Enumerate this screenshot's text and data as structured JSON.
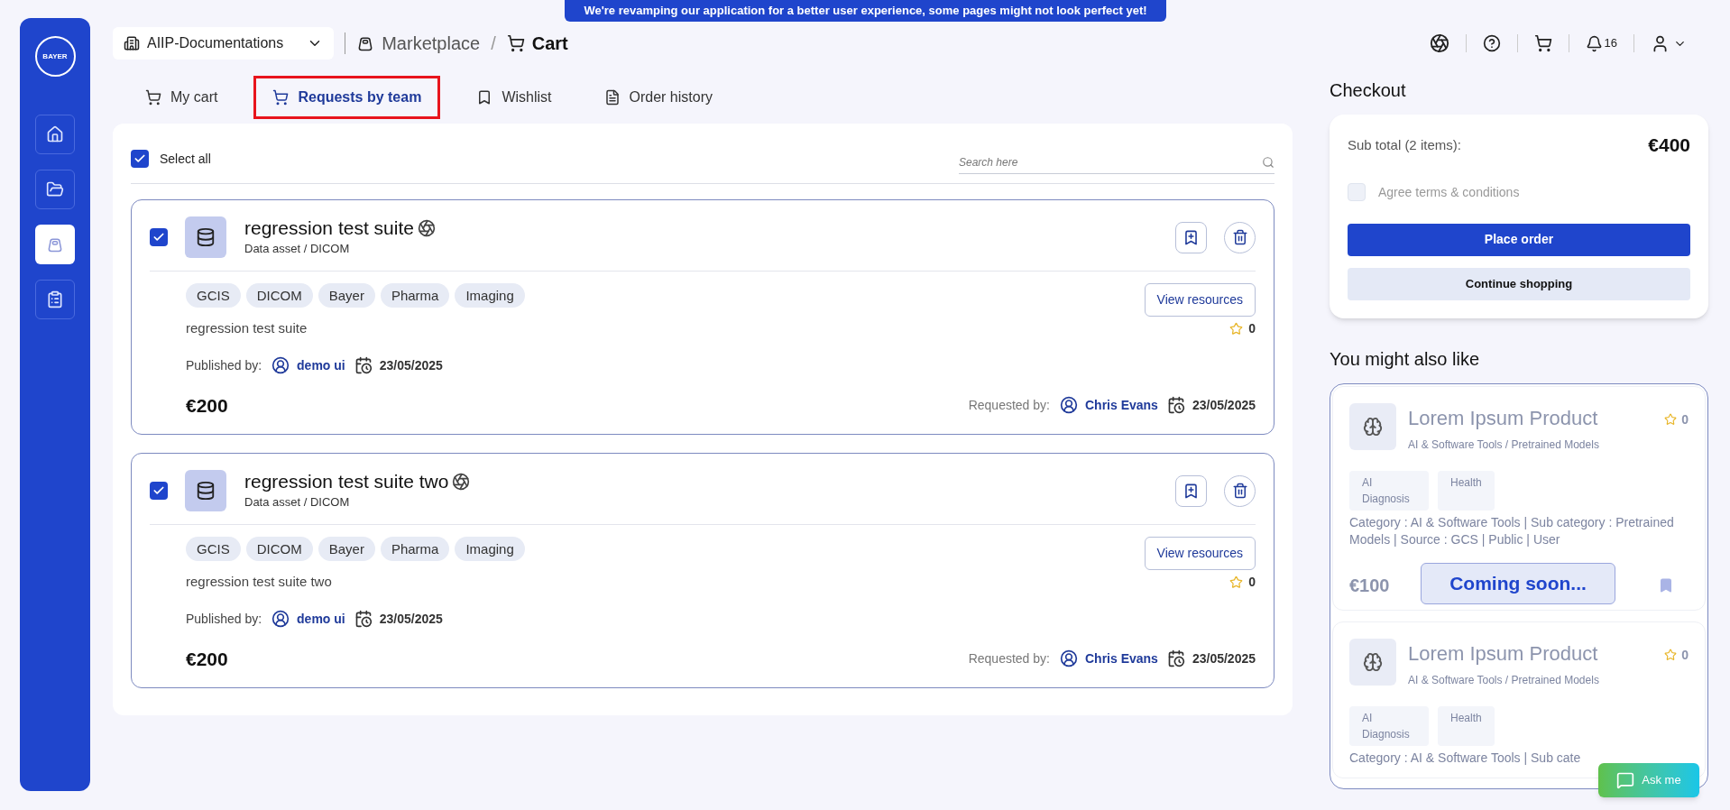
{
  "banner": "We're revamping our application for a better user experience, some pages might not look perfect yet!",
  "sidebar": {
    "logo": "BAYER",
    "items": [
      {
        "kind": "home",
        "selected": false
      },
      {
        "kind": "folder",
        "selected": false
      },
      {
        "kind": "marketplace",
        "selected": true
      },
      {
        "kind": "clipboard",
        "selected": false
      }
    ]
  },
  "workspace": "AIIP-Documentations",
  "breadcrumb": [
    {
      "label": "Marketplace",
      "current": false
    },
    {
      "label": "Cart",
      "current": true
    }
  ],
  "breadcrumb_separator": "/",
  "notifications": "16",
  "tabs": [
    {
      "label": "My cart",
      "kind": "cart",
      "selected": false
    },
    {
      "label": "Requests by team",
      "kind": "team",
      "selected": true
    },
    {
      "label": "Wishlist",
      "kind": "wishlist",
      "selected": false
    },
    {
      "label": "Order history",
      "kind": "history",
      "selected": false
    }
  ],
  "select_all": {
    "label": "Select all",
    "checked": true
  },
  "search": {
    "placeholder": "Search here"
  },
  "items": [
    {
      "checked": true,
      "title": "regression test suite",
      "subtitle": "Data asset / DICOM",
      "tags": [
        "GCIS",
        "DICOM",
        "Bayer",
        "Pharma",
        "Imaging"
      ],
      "view_button": "View resources",
      "description": "regression test suite",
      "rating": "0",
      "published_label": "Published by:",
      "publisher": "demo ui",
      "published_date": "23/05/2025",
      "price": "€200",
      "requested_label": "Requested by:",
      "requester": "Chris Evans",
      "requested_date": "23/05/2025"
    },
    {
      "checked": true,
      "title": "regression test suite two",
      "subtitle": "Data asset / DICOM",
      "tags": [
        "GCIS",
        "DICOM",
        "Bayer",
        "Pharma",
        "Imaging"
      ],
      "view_button": "View resources",
      "description": "regression test suite two",
      "rating": "0",
      "published_label": "Published by:",
      "publisher": "demo ui",
      "published_date": "23/05/2025",
      "price": "€200",
      "requested_label": "Requested by:",
      "requester": "Chris Evans",
      "requested_date": "23/05/2025"
    }
  ],
  "checkout": {
    "title": "Checkout",
    "subtotal_label": "Sub total (2 items):",
    "subtotal": "€400",
    "agree": {
      "label": "Agree terms & conditions",
      "checked": false
    },
    "place_order": "Place order",
    "continue": "Continue shopping"
  },
  "recommendations": {
    "title": "You might also like",
    "overlay": "Coming soon...",
    "products": [
      {
        "title": "Lorem Ipsum Product",
        "category_path": "AI & Software Tools / Pretrained Models",
        "rating": "0",
        "tags": [
          "AI Diagnosis",
          "Health"
        ],
        "details": "Category : AI & Software Tools | Sub category : Pretrained Models | Source : GCS | Public | User",
        "price": "€100"
      },
      {
        "title": "Lorem Ipsum Product",
        "category_path": "AI & Software Tools / Pretrained Models",
        "rating": "0",
        "tags": [
          "AI Diagnosis",
          "Health"
        ],
        "details": "Category : AI & Software Tools | Sub cate"
      }
    ]
  },
  "ask_me": "Ask me"
}
